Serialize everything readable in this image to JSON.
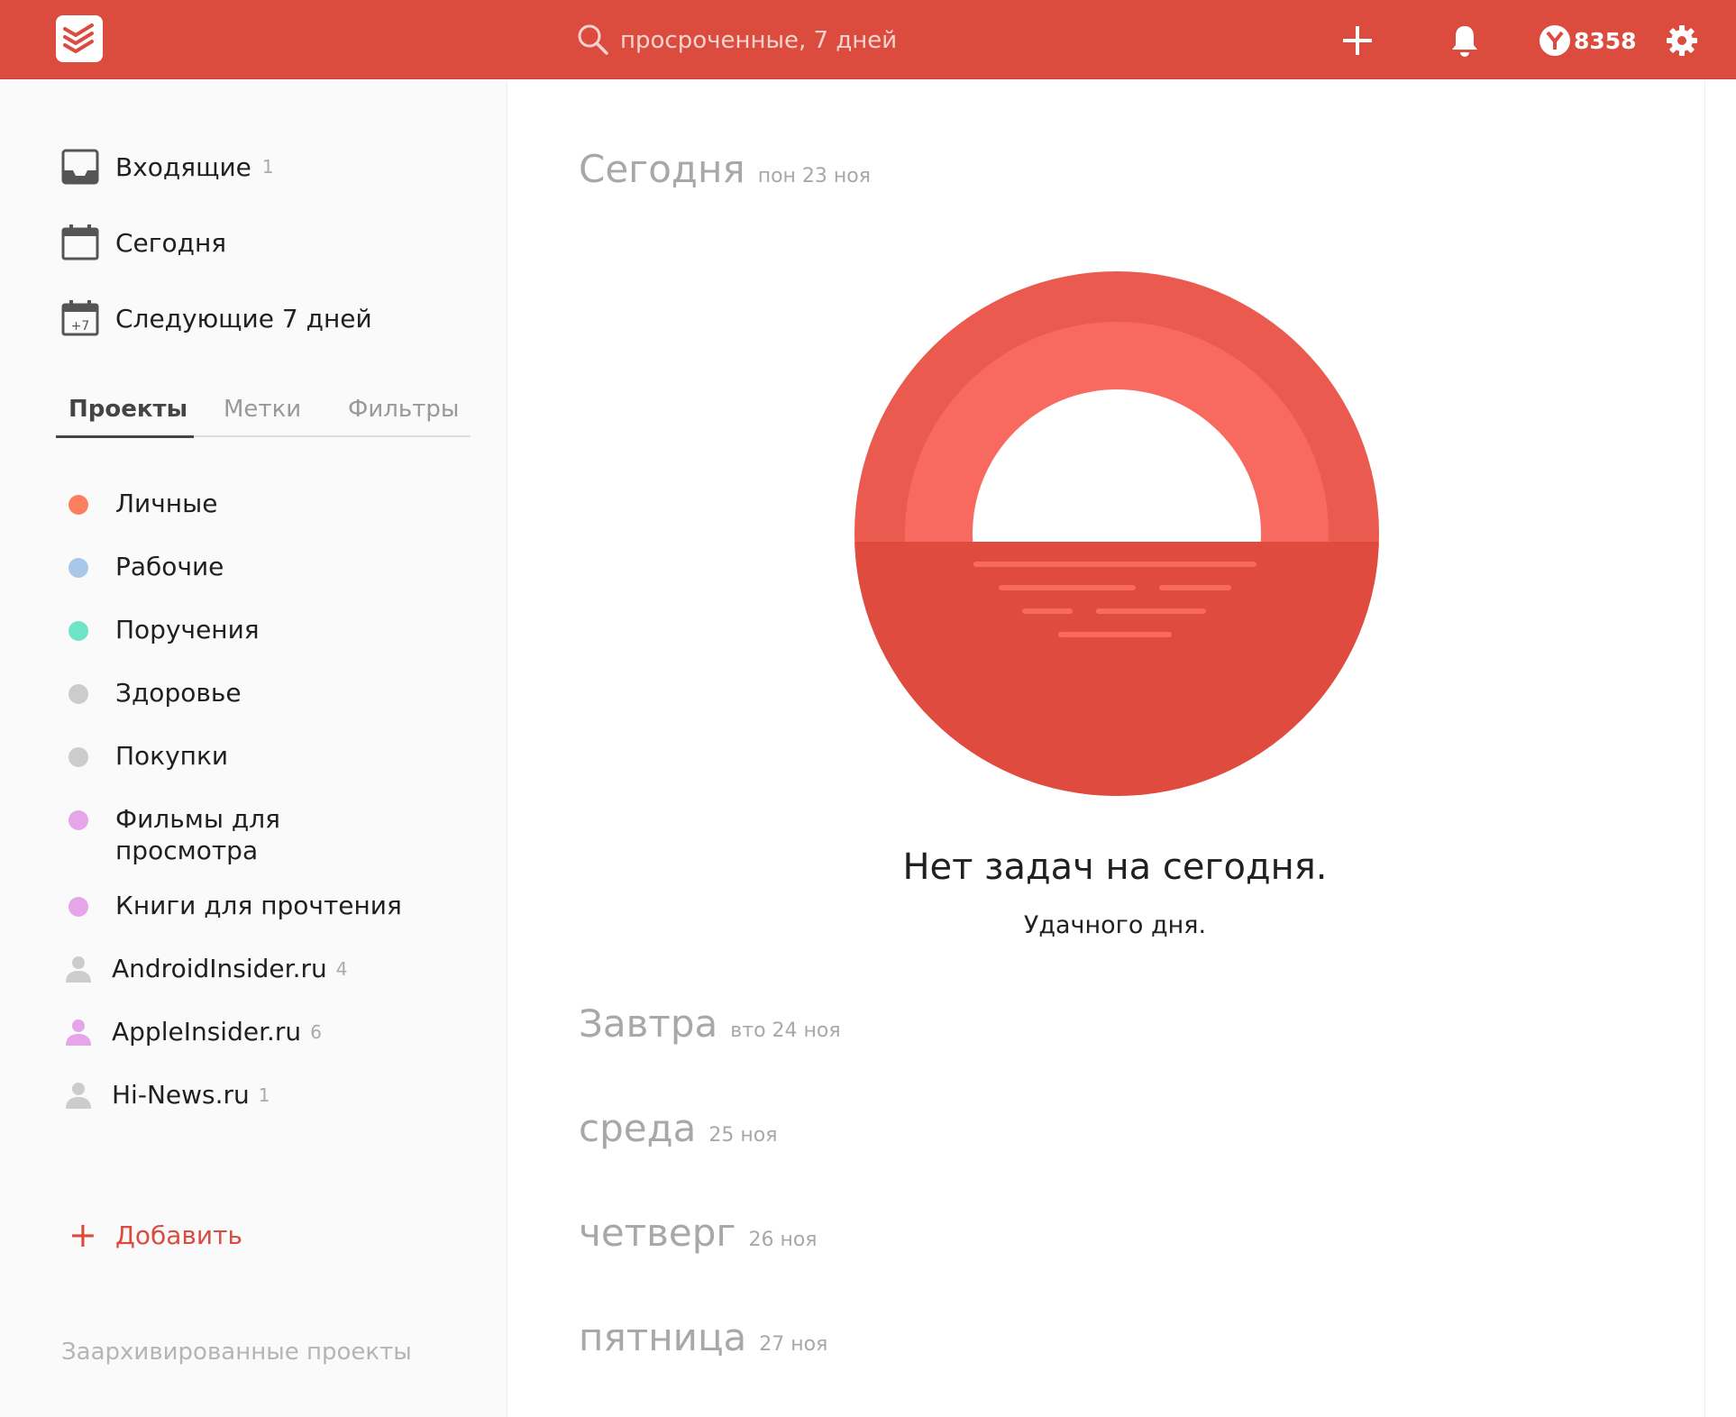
{
  "colors": {
    "brand": "#db4c3f"
  },
  "topbar": {
    "logo_icon": "todoist-logo-icon",
    "search": {
      "placeholder": "просроченные, 7 дней",
      "value": ""
    },
    "karma": "8358"
  },
  "sidebar": {
    "nav": [
      {
        "label": "Входящие",
        "count": "1",
        "icon": "inbox-icon"
      },
      {
        "label": "Сегодня",
        "count": "",
        "icon": "calendar-icon"
      },
      {
        "label": "Следующие 7 дней",
        "count": "",
        "icon": "calendar-plus7-icon",
        "icon_text": "+7"
      }
    ],
    "tabs": [
      {
        "label": "Проекты",
        "active": true
      },
      {
        "label": "Метки",
        "active": false
      },
      {
        "label": "Фильтры",
        "active": false
      }
    ],
    "projects": [
      {
        "label": "Личные",
        "count": "",
        "color": "#fc8060",
        "shared": false
      },
      {
        "label": "Рабочие",
        "count": "",
        "color": "#a8c8e8",
        "shared": false
      },
      {
        "label": "Поручения",
        "count": "",
        "color": "#6ee4c8",
        "shared": false
      },
      {
        "label": "Здоровье",
        "count": "",
        "color": "#cccccc",
        "shared": false
      },
      {
        "label": "Покупки",
        "count": "",
        "color": "#cccccc",
        "shared": false
      },
      {
        "label": "Фильмы для просмотра",
        "count": "",
        "color": "#e5a5e8",
        "shared": false
      },
      {
        "label": "Книги для прочтения",
        "count": "",
        "color": "#e5a5e8",
        "shared": false
      },
      {
        "label": "AndroidInsider.ru",
        "count": "4",
        "color": "#cccccc",
        "shared": true
      },
      {
        "label": "AppleInsider.ru",
        "count": "6",
        "color": "#e5a5e8",
        "shared": true
      },
      {
        "label": "Hi-News.ru",
        "count": "1",
        "color": "#cccccc",
        "shared": true
      }
    ],
    "add_label": "Добавить",
    "archived_label": "Заархивированные проекты"
  },
  "main": {
    "today": {
      "day": "Сегодня",
      "date": "пон 23 ноя"
    },
    "empty": {
      "title": "Нет задач на сегодня.",
      "subtitle": "Удачного дня."
    },
    "days": [
      {
        "day": "Завтра",
        "date": "вто 24 ноя"
      },
      {
        "day": "среда",
        "date": "25 ноя"
      },
      {
        "day": "четверг",
        "date": "26 ноя"
      },
      {
        "day": "пятница",
        "date": "27 ноя"
      }
    ]
  }
}
